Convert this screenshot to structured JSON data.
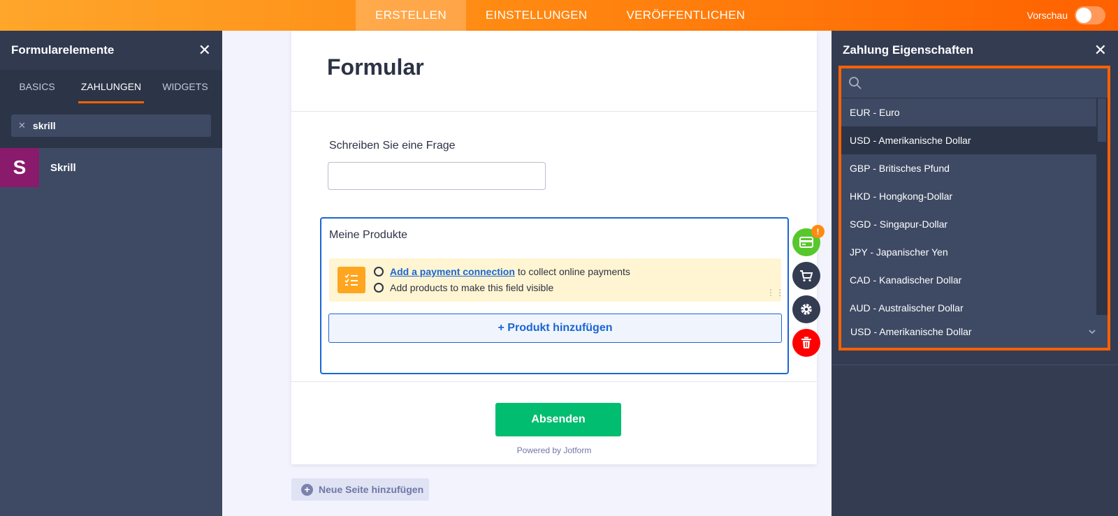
{
  "topbar": {
    "tabs": [
      "ERSTELLEN",
      "EINSTELLUNGEN",
      "VERÖFFENTLICHEN"
    ],
    "active_tab": "ERSTELLEN",
    "preview_label": "Vorschau"
  },
  "left_panel": {
    "title": "Formularelemente",
    "tabs": [
      "BASICS",
      "ZAHLUNGEN",
      "WIDGETS"
    ],
    "active_tab": "ZAHLUNGEN",
    "search_value": "skrill",
    "results": [
      {
        "label": "Skrill",
        "logo_letter": "S"
      }
    ]
  },
  "form": {
    "title": "Formular",
    "question_label": "Schreiben Sie eine Frage",
    "products": {
      "title": "Meine Produkte",
      "notice_link": "Add a payment connection",
      "notice_text1": "to collect online payments",
      "notice_text2": "Add products to make this field visible",
      "add_button": "+ Produkt hinzufügen"
    },
    "submit_label": "Absenden",
    "powered_by": "Powered by Jotform",
    "warning_badge": "!"
  },
  "new_page_label": "Neue Seite hinzufügen",
  "right_panel": {
    "title": "Zahlung Eigenschaften",
    "currency_options": [
      "EUR - Euro",
      "USD - Amerikanische Dollar",
      "GBP - Britisches Pfund",
      "HKD - Hongkong-Dollar",
      "SGD - Singapur-Dollar",
      "JPY - Japanischer Yen",
      "CAD - Kanadischer Dollar",
      "AUD - Australischer Dollar"
    ],
    "highlighted_option": "USD - Amerikanische Dollar",
    "selected_value": "USD - Amerikanische Dollar"
  },
  "colors": {
    "accent": "#ff6100",
    "link": "#1a66d4",
    "submit": "#01bd6f",
    "panel": "#343c52"
  }
}
